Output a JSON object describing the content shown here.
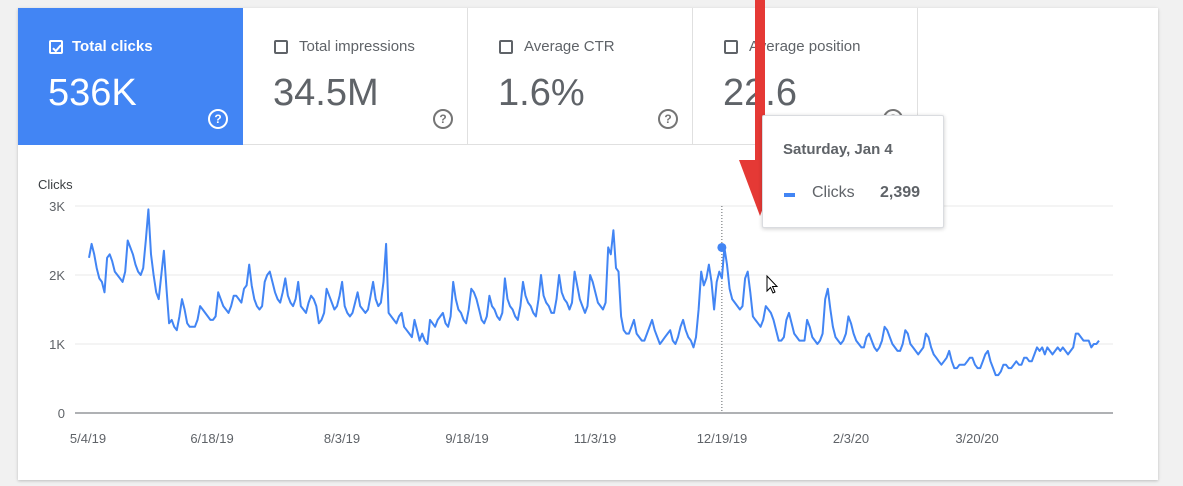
{
  "metrics": [
    {
      "label": "Total clicks",
      "value": "536K",
      "checked": true
    },
    {
      "label": "Total impressions",
      "value": "34.5M",
      "checked": false
    },
    {
      "label": "Average CTR",
      "value": "1.6%",
      "checked": false
    },
    {
      "label": "Average position",
      "value": "22.6",
      "checked": false
    }
  ],
  "help_icon_glyph": "?",
  "colors": {
    "accent": "#4285f4",
    "annotation_arrow": "#e53935"
  },
  "tooltip": {
    "date": "Saturday, Jan 4",
    "series": "Clicks",
    "value": "2,399"
  },
  "chart_data": {
    "type": "line",
    "ylabel": "Clicks",
    "ylim": [
      0,
      3000
    ],
    "yticks": [
      {
        "value": 0,
        "label": "0"
      },
      {
        "value": 1000,
        "label": "1K"
      },
      {
        "value": 2000,
        "label": "2K"
      },
      {
        "value": 3000,
        "label": "3K"
      }
    ],
    "xticks": [
      "5/4/19",
      "6/18/19",
      "8/3/19",
      "9/18/19",
      "11/3/19",
      "12/19/19",
      "2/3/20",
      "3/20/20"
    ],
    "grid": true,
    "highlight": {
      "index": 245,
      "value": 2399
    },
    "series": [
      {
        "name": "Clicks",
        "values": [
          2250,
          2450,
          2300,
          2100,
          1950,
          1900,
          1750,
          2250,
          2300,
          2200,
          2050,
          2000,
          1950,
          1900,
          2050,
          2500,
          2400,
          2300,
          2150,
          2050,
          2000,
          2100,
          2500,
          2950,
          2300,
          2000,
          1750,
          1650,
          2000,
          2350,
          1800,
          1300,
          1350,
          1250,
          1200,
          1400,
          1650,
          1500,
          1300,
          1250,
          1250,
          1250,
          1350,
          1550,
          1500,
          1450,
          1400,
          1350,
          1350,
          1400,
          1750,
          1650,
          1550,
          1500,
          1450,
          1550,
          1700,
          1700,
          1650,
          1600,
          1800,
          1850,
          2150,
          1850,
          1650,
          1550,
          1500,
          1550,
          1900,
          2000,
          2050,
          1900,
          1750,
          1650,
          1600,
          1750,
          1950,
          1700,
          1600,
          1550,
          1650,
          1900,
          1550,
          1500,
          1450,
          1600,
          1700,
          1650,
          1550,
          1300,
          1350,
          1450,
          1800,
          1700,
          1600,
          1500,
          1550,
          1700,
          1900,
          1550,
          1450,
          1400,
          1450,
          1600,
          1750,
          1550,
          1500,
          1450,
          1500,
          1700,
          1900,
          1650,
          1550,
          1600,
          1900,
          2450,
          1450,
          1400,
          1350,
          1300,
          1400,
          1450,
          1250,
          1200,
          1150,
          1100,
          1350,
          1200,
          1050,
          1150,
          1050,
          1000,
          1350,
          1300,
          1250,
          1350,
          1400,
          1450,
          1300,
          1250,
          1400,
          1900,
          1650,
          1500,
          1450,
          1350,
          1300,
          1500,
          1800,
          1750,
          1650,
          1500,
          1350,
          1300,
          1400,
          1700,
          1550,
          1500,
          1400,
          1350,
          1450,
          1950,
          1650,
          1550,
          1500,
          1400,
          1350,
          1550,
          1900,
          1700,
          1600,
          1550,
          1450,
          1400,
          1650,
          2000,
          1700,
          1600,
          1550,
          1450,
          1450,
          1650,
          2000,
          1750,
          1650,
          1600,
          1500,
          1600,
          2050,
          1850,
          1650,
          1550,
          1450,
          1550,
          2000,
          1900,
          1750,
          1600,
          1550,
          1500,
          1600,
          2400,
          2300,
          2650,
          2100,
          2050,
          1400,
          1200,
          1150,
          1150,
          1250,
          1350,
          1150,
          1100,
          1050,
          1050,
          1150,
          1250,
          1350,
          1200,
          1100,
          1000,
          1050,
          1100,
          1150,
          1200,
          1050,
          1000,
          1100,
          1250,
          1350,
          1200,
          1100,
          1050,
          950,
          1100,
          1500,
          2050,
          1850,
          1950,
          2150,
          1900,
          1500,
          1900,
          2050,
          1950,
          2399,
          2150,
          1800,
          1650,
          1600,
          1550,
          1500,
          1550,
          1950,
          2050,
          1750,
          1400,
          1350,
          1300,
          1250,
          1350,
          1550,
          1500,
          1450,
          1350,
          1200,
          1050,
          1050,
          1100,
          1350,
          1450,
          1300,
          1150,
          1100,
          1050,
          1050,
          1050,
          1350,
          1250,
          1100,
          1050,
          1000,
          1050,
          1150,
          1650,
          1800,
          1500,
          1250,
          1100,
          1050,
          1000,
          1050,
          1150,
          1400,
          1300,
          1150,
          1050,
          1000,
          950,
          950,
          1100,
          1150,
          1050,
          950,
          900,
          950,
          1050,
          1250,
          1200,
          1100,
          1000,
          950,
          900,
          900,
          1000,
          1200,
          1150,
          1000,
          950,
          900,
          850,
          900,
          950,
          1150,
          1100,
          950,
          850,
          800,
          750,
          700,
          750,
          800,
          900,
          750,
          650,
          650,
          700,
          700,
          700,
          750,
          800,
          800,
          700,
          650,
          650,
          750,
          850,
          900,
          750,
          650,
          550,
          550,
          600,
          700,
          700,
          650,
          650,
          700,
          750,
          700,
          700,
          800,
          800,
          750,
          750,
          850,
          950,
          900,
          950,
          850,
          950,
          900,
          850,
          900,
          950,
          900,
          950,
          900,
          850,
          900,
          950,
          1150,
          1150,
          1100,
          1050,
          1050,
          1050,
          950,
          1000,
          1000,
          1050
        ]
      }
    ]
  }
}
